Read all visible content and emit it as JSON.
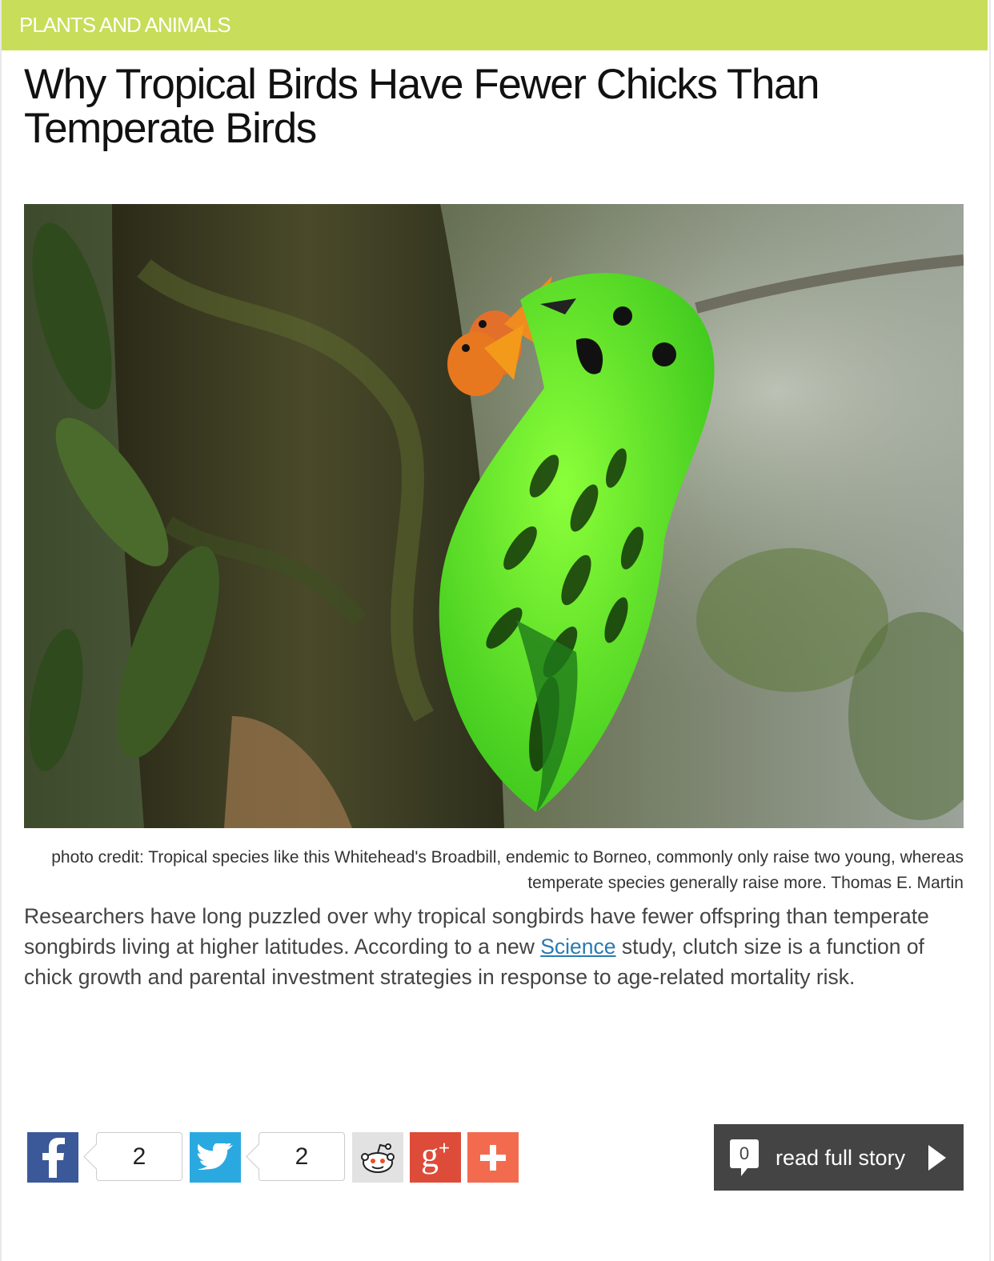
{
  "category": {
    "label": "PLANTS AND ANIMALS",
    "color": "#c8dd5a"
  },
  "article": {
    "title": "Why Tropical Birds Have Fewer Chicks Than Temperate Birds",
    "photo_caption": "photo credit: Tropical species like this Whitehead's Broadbill, endemic to Borneo, commonly only raise two young, whereas temperate species generally raise more. Thomas E. Martin",
    "summary_before_link": "Researchers have long puzzled over why tropical songbirds have fewer offspring than temperate songbirds living at higher latitudes. According to a new ",
    "summary_link": "Science",
    "summary_after_link": " study, clutch size is a function of chick growth and parental investment strategies in response to age-related mortality risk."
  },
  "share": {
    "facebook": {
      "icon": "facebook-icon",
      "count": "2",
      "color": "#3b5998"
    },
    "twitter": {
      "icon": "twitter-icon",
      "count": "2",
      "color": "#2aa9e0"
    },
    "reddit": {
      "icon": "reddit-icon"
    },
    "google_plus": {
      "icon": "google-plus-icon",
      "glyph": "g",
      "sup": "+",
      "color": "#dd4b39"
    },
    "addthis": {
      "icon": "plus-icon",
      "color": "#f26b4e"
    }
  },
  "read_more": {
    "comment_count": "0",
    "label": "read full story",
    "icon": "play-arrow-icon"
  }
}
